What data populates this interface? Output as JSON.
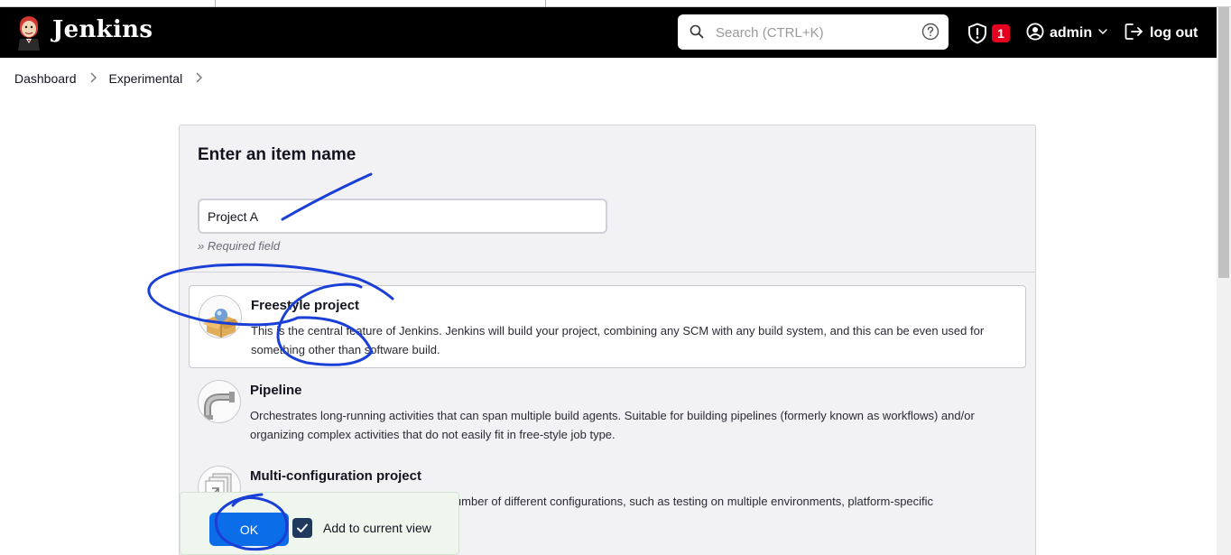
{
  "header": {
    "brand": "Jenkins",
    "search_placeholder": "Search (CTRL+K)",
    "alert_count": "1",
    "user": "admin",
    "logout_label": "log out"
  },
  "breadcrumb": [
    "Dashboard",
    "Experimental"
  ],
  "form": {
    "title": "Enter an item name",
    "name_value": "Project A",
    "required_note": "» Required field"
  },
  "item_types": [
    {
      "title": "Freestyle project",
      "description": "This is the central feature of Jenkins. Jenkins will build your project, combining any SCM with any build system, and this can be even used for something other than software build.",
      "selected": true
    },
    {
      "title": "Pipeline",
      "description": "Orchestrates long-running activities that can span multiple build agents. Suitable for building pipelines (formerly known as workflows) and/or organizing complex activities that do not easily fit in free-style job type.",
      "selected": false
    },
    {
      "title": "Multi-configuration project",
      "description": "Suitable for projects that need a large number of different configurations, such as testing on multiple environments, platform-specific",
      "selected": false
    }
  ],
  "footer": {
    "ok_label": "OK",
    "add_to_view_label": "Add to current view",
    "add_to_view_checked": true
  },
  "colors": {
    "header_bg": "#000000",
    "primary_button": "#0b6ee8",
    "badge": "#e6001f",
    "annotation_ink": "#1a3fd6"
  }
}
